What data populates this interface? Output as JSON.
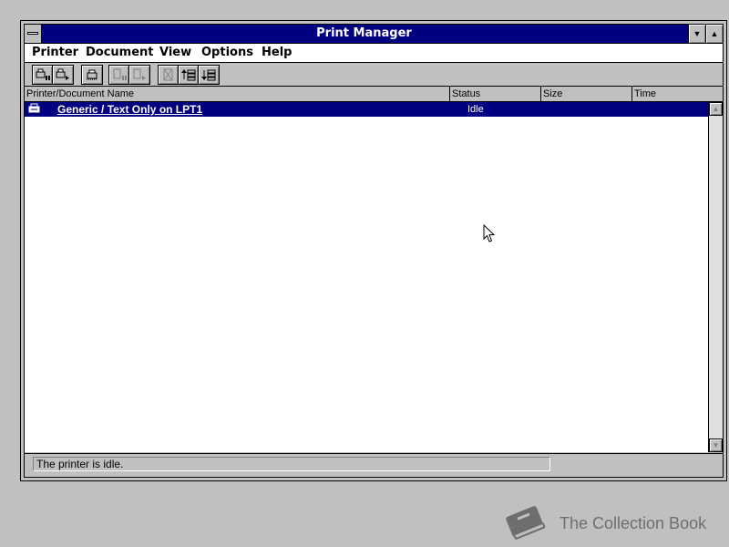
{
  "window": {
    "title": "Print Manager"
  },
  "menu": [
    "Printer",
    "Document",
    "View",
    "Options",
    "Help"
  ],
  "toolbar": {
    "groups": [
      [
        "pause-printer-icon",
        "resume-printer-icon"
      ],
      [
        "printer-setup-icon"
      ],
      [
        "pause-document-icon",
        "resume-document-icon"
      ],
      [
        "delete-document-icon",
        "move-up-icon",
        "move-down-icon"
      ]
    ]
  },
  "columns": [
    "Printer/Document Name",
    "Status",
    "Size",
    "Time"
  ],
  "rows": [
    {
      "name": "Generic / Text Only on LPT1",
      "status": "Idle",
      "size": "",
      "time": "",
      "selected": true
    }
  ],
  "statusbar": {
    "text": "The printer is idle."
  },
  "watermark": {
    "text": "The Collection Book"
  },
  "colors": {
    "titlebar": "#000080",
    "selection": "#000080",
    "chrome": "#c0c0c0"
  }
}
